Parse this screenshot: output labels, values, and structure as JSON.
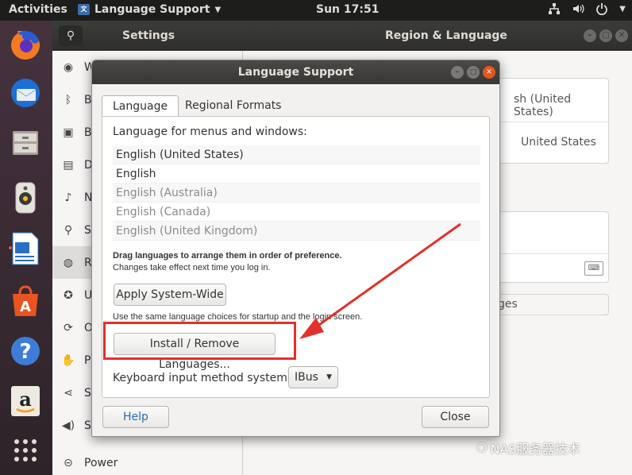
{
  "topbar": {
    "activities": "Activities",
    "app_name": "Language Support",
    "clock": "Sun 17:51"
  },
  "settings": {
    "title": "Settings",
    "panel_title": "Region & Language",
    "sidebar": [
      {
        "icon": "wifi-icon",
        "label": "W"
      },
      {
        "icon": "bluetooth-icon",
        "label": "B"
      },
      {
        "icon": "background-icon",
        "label": "B"
      },
      {
        "icon": "dock-icon",
        "label": "D"
      },
      {
        "icon": "bell-icon",
        "label": "N"
      },
      {
        "icon": "search-icon",
        "label": "Se"
      },
      {
        "icon": "region-icon",
        "label": "R"
      },
      {
        "icon": "accessibility-icon",
        "label": "U"
      },
      {
        "icon": "online-accounts-icon",
        "label": "O"
      },
      {
        "icon": "privacy-icon",
        "label": "P"
      },
      {
        "icon": "share-icon",
        "label": "Sl"
      },
      {
        "icon": "sound-icon",
        "label": "Sc"
      },
      {
        "icon": "power-icon",
        "label": "Power"
      }
    ],
    "right": {
      "language_value": "sh (United States)",
      "formats_value": "United States",
      "manage_button": "ges"
    }
  },
  "dialog": {
    "title": "Language Support",
    "tabs": [
      "Language",
      "Regional Formats"
    ],
    "menus_label": "Language for menus and windows:",
    "languages": [
      "English (United States)",
      "English",
      "English (Australia)",
      "English (Canada)",
      "English (United Kingdom)"
    ],
    "drag_hint": "Drag languages to arrange them in order of preference.",
    "changes_hint": "Changes take effect next time you log in.",
    "apply_button": "Apply System-Wide",
    "apply_hint": "Use the same language choices for startup and the login screen.",
    "install_button": "Install / Remove Languages...",
    "im_label": "Keyboard input method system:",
    "im_value": "IBus",
    "help_button": "Help",
    "close_button": "Close"
  },
  "watermark": "NAS服务器技术",
  "colors": {
    "highlight": "#e0312b",
    "accent": "#e95420"
  }
}
